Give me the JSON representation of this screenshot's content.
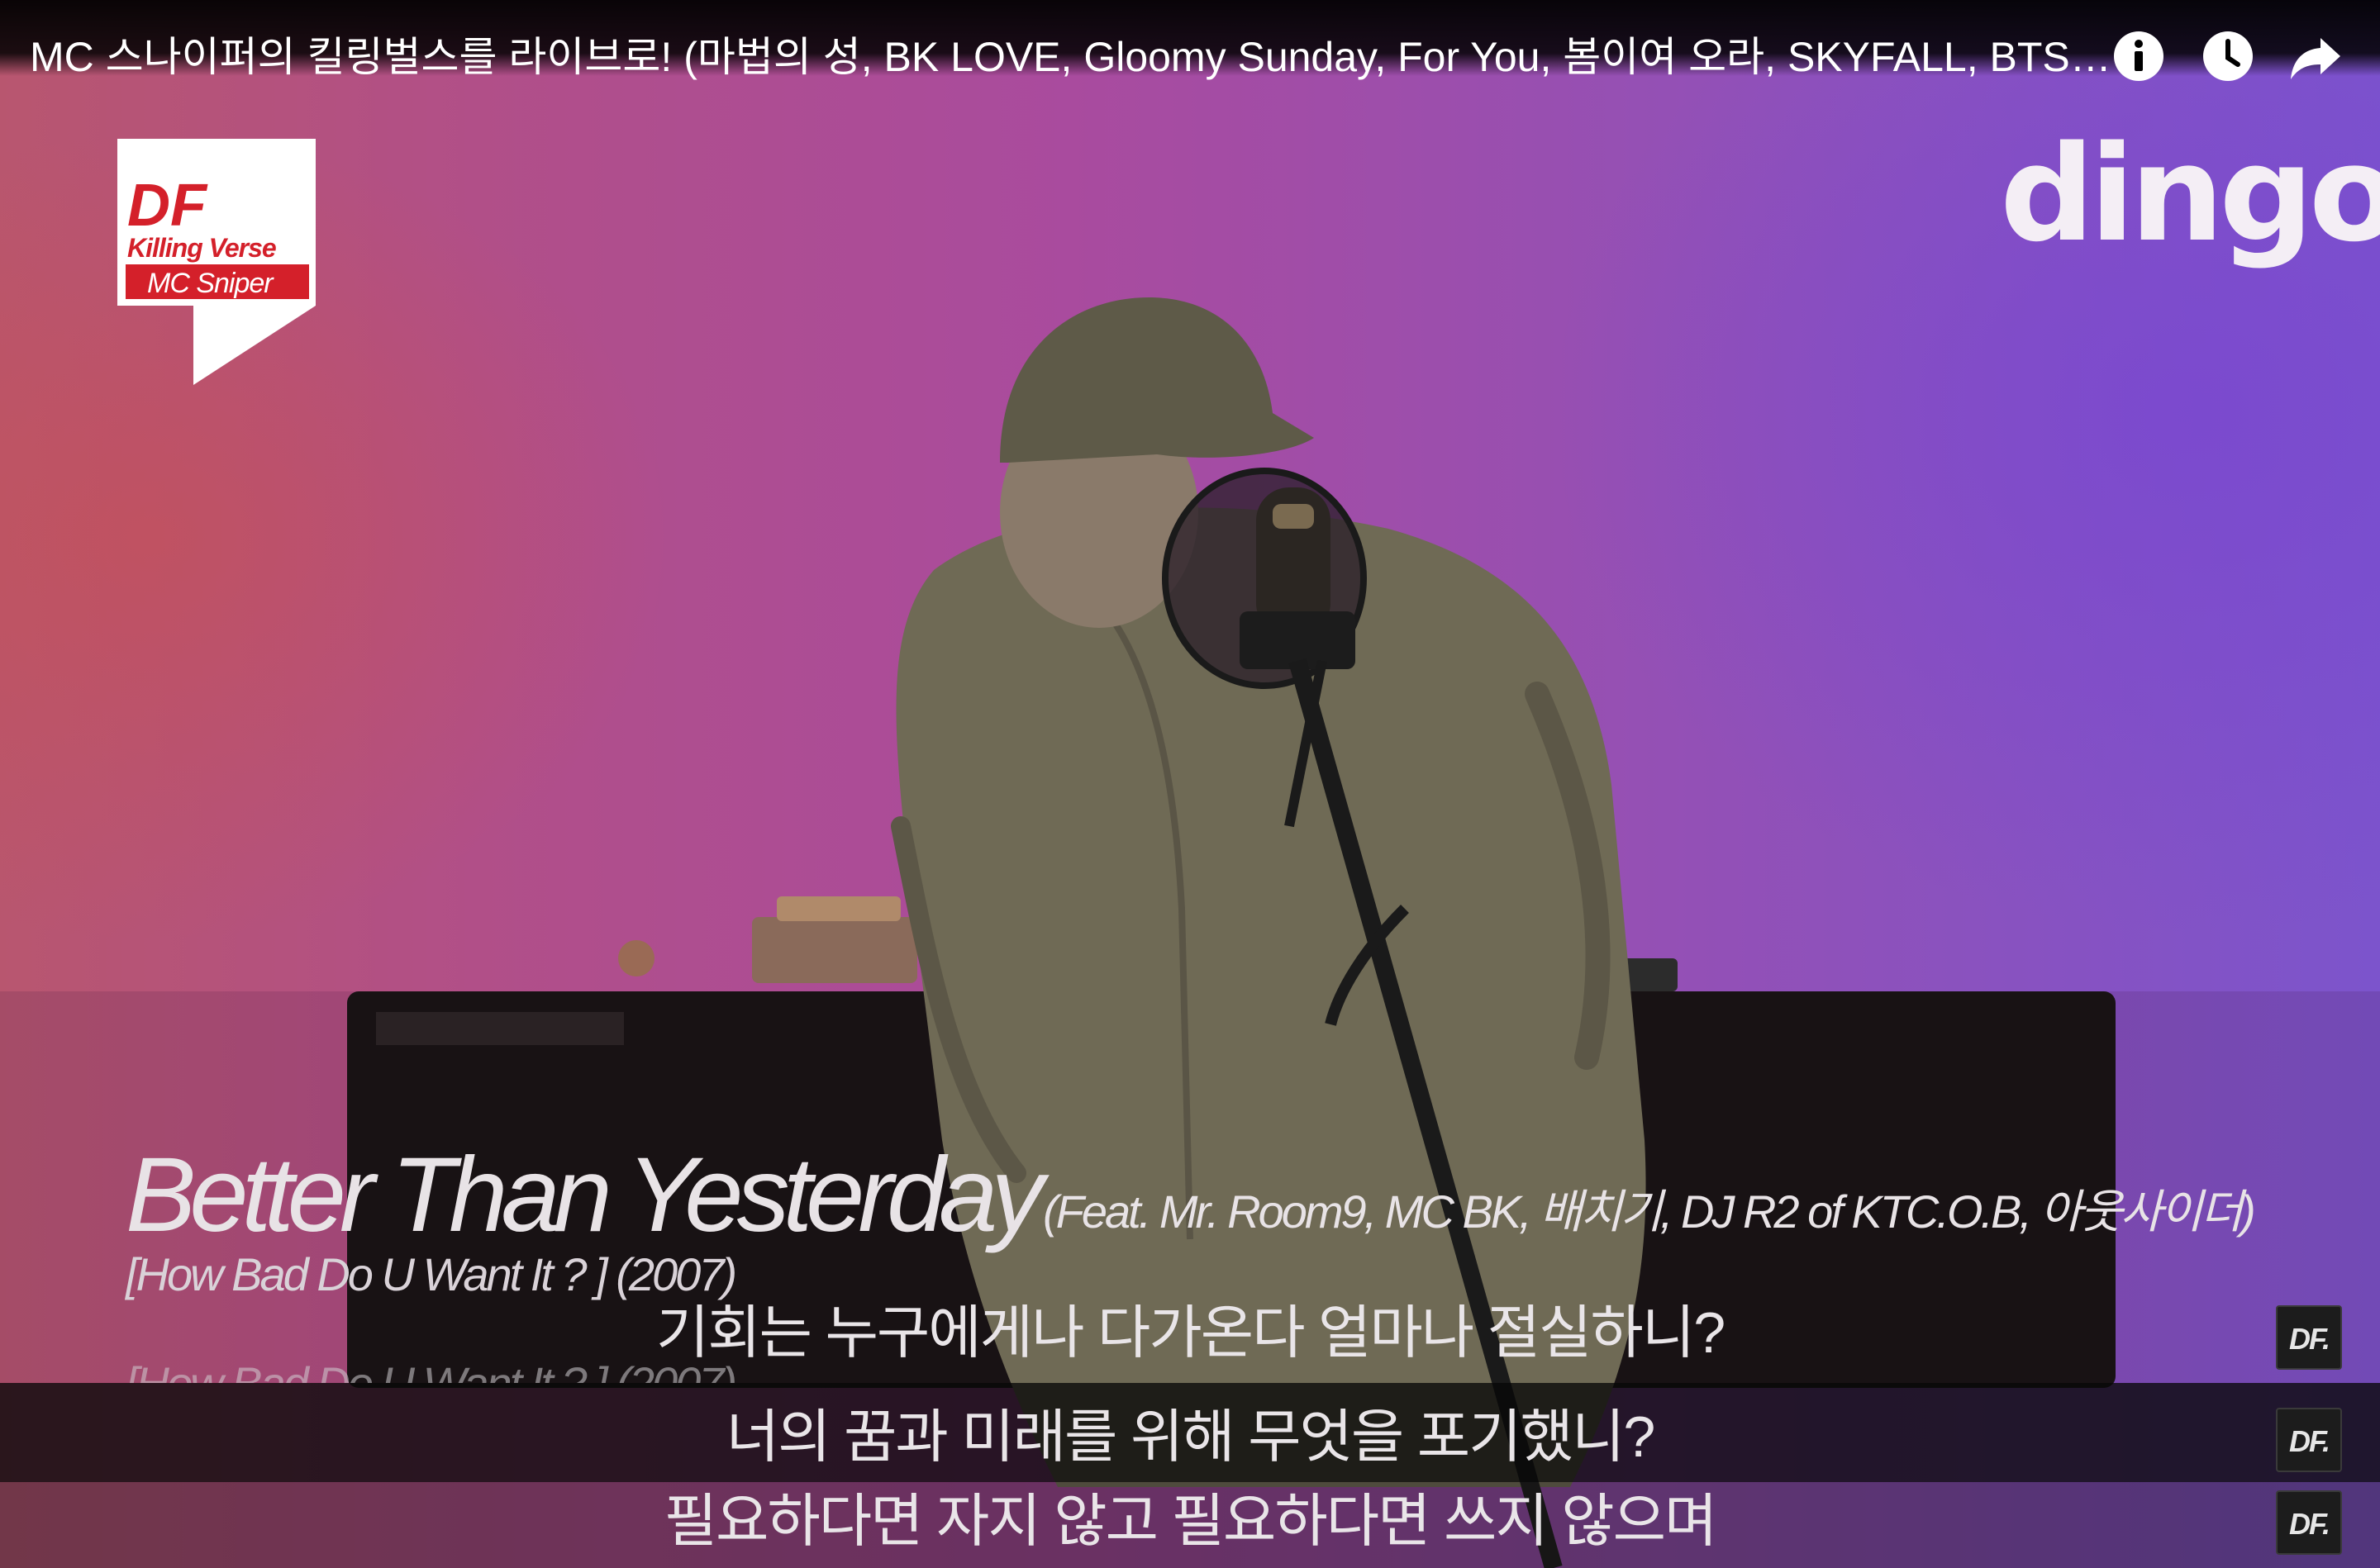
{
  "video": {
    "title": "MC 스나이퍼의 킬링벌스를 라이브로! (마법의 성, BK LOVE, Gloomy Sunday, For You, 봄이여 오라, SKYFALL, BTS 외) | 딩고뮤직 | Dingo Music"
  },
  "top_controls": [
    {
      "name": "info-icon",
      "label": "Info"
    },
    {
      "name": "watch-later-icon",
      "label": "Watch later"
    },
    {
      "name": "share-icon",
      "label": "Share"
    }
  ],
  "branding": {
    "df_badge_top": "DF",
    "df_badge_line": "Killing Verse",
    "df_badge_artist": "MC Sniper",
    "channel_logo": "dingo"
  },
  "song": {
    "title": "Better Than Yesterday",
    "feat": "(Feat. Mr. Room9, MC BK, 배치기, DJ R2 of KTC.O.B, 아웃사이더)",
    "album": "[How Bad Do U Want It ? ] (2007)"
  },
  "captions": [
    {
      "text": "기회는 누구에게나 다가온다 얼마나 절실하니?",
      "badge": "DF."
    },
    {
      "text": "너의 꿈과 미래를 위해 무엇을 포기했니?",
      "badge": "DF."
    },
    {
      "text": "필요하다면 자지 않고 필요하다면 쓰지 않으며",
      "badge": "DF."
    }
  ],
  "colors": {
    "background_left": "#b8566f",
    "background_right": "#7c54cc",
    "jacket": "#6f6a55",
    "table": "#1a1416",
    "badge_red": "#d4202a"
  }
}
